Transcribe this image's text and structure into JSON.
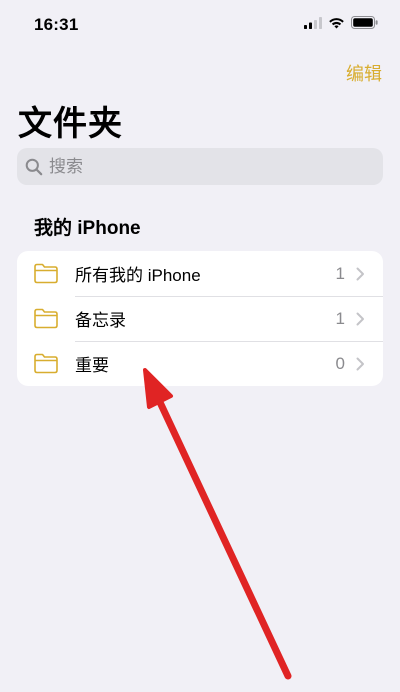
{
  "status_bar": {
    "time": "16:31"
  },
  "header": {
    "edit_label": "编辑",
    "title": "文件夹"
  },
  "search": {
    "placeholder": "搜索"
  },
  "section": {
    "title": "我的 iPhone"
  },
  "folders": [
    {
      "name": "所有我的 iPhone",
      "count": "1"
    },
    {
      "name": "备忘录",
      "count": "1"
    },
    {
      "name": "重要",
      "count": "0"
    }
  ],
  "colors": {
    "accent": "#d8ad2f",
    "arrow": "#e02424",
    "background": "#f1f0f6"
  },
  "icons": [
    "cellular-signal-icon",
    "wifi-icon",
    "battery-icon",
    "search-icon",
    "folder-icon",
    "chevron-right-icon"
  ]
}
